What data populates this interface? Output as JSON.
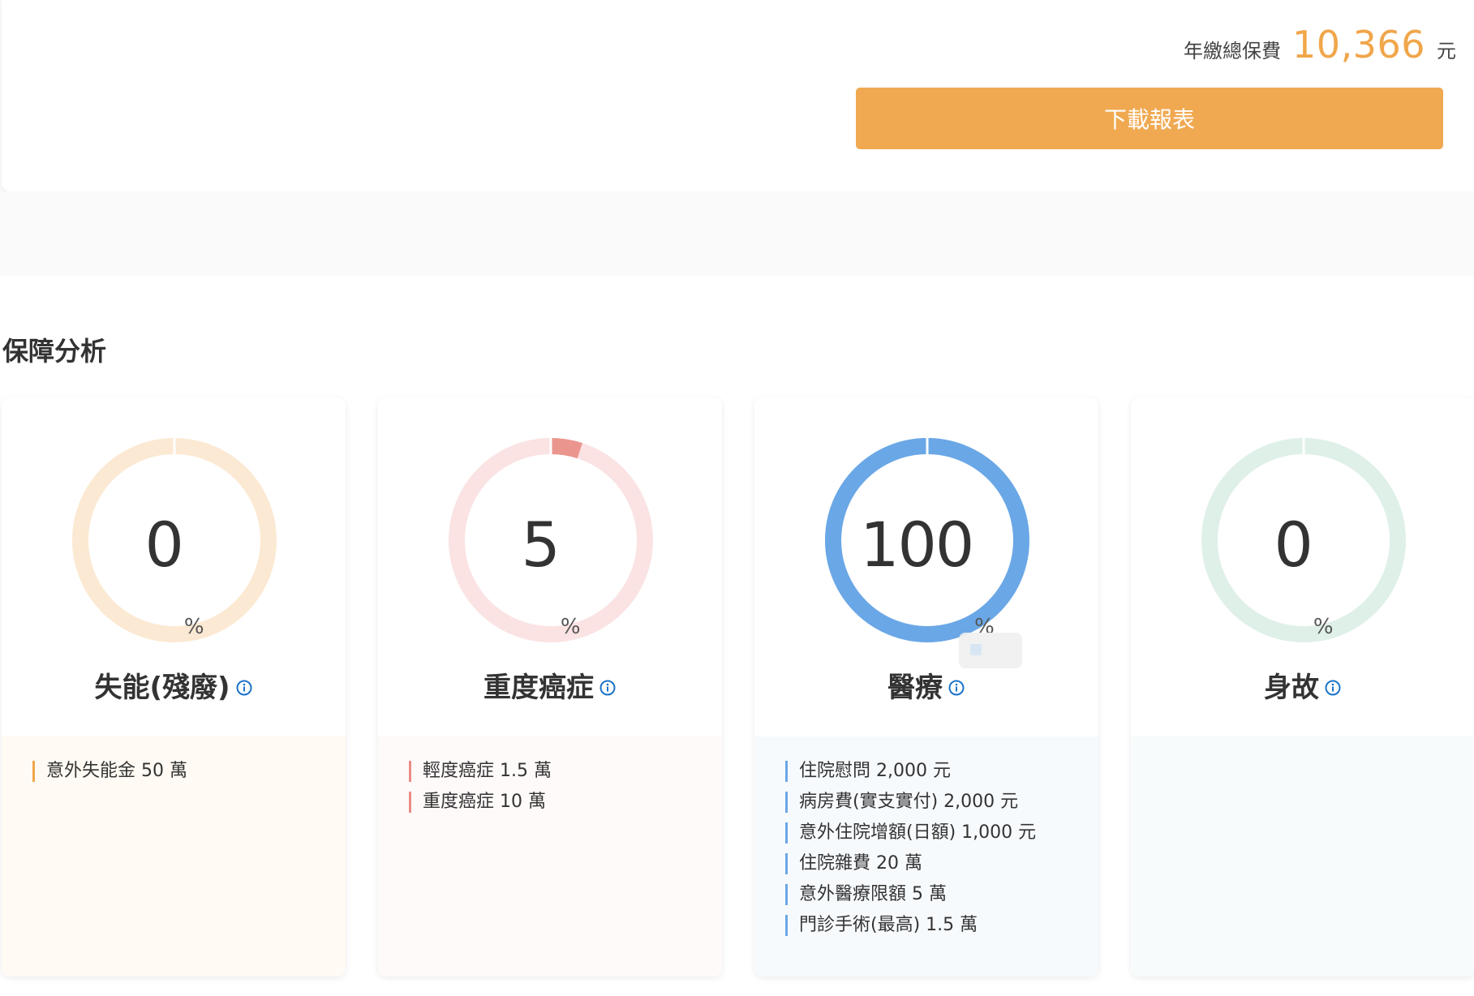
{
  "premium": {
    "label": "年繳總保費",
    "value": "10,366",
    "unit": "元"
  },
  "download_button": "下載報表",
  "section_title": "保障分析",
  "cards": [
    {
      "title": "失能(殘廢)",
      "percent": "0",
      "percent_symbol": "%",
      "progress": 0,
      "ring_color": "#fce9d3",
      "fill_color": "#f0a64a",
      "body_bg": "#fffaf3",
      "bar_color": "#f0a64a",
      "items": [
        "意外失能金 50 萬"
      ]
    },
    {
      "title": "重度癌症",
      "percent": "5",
      "percent_symbol": "%",
      "progress": 0.05,
      "ring_color": "#fbe3e3",
      "fill_color": "#eb958f",
      "body_bg": "#fefaf9",
      "bar_color": "#eb8c86",
      "items": [
        "輕度癌症 1.5 萬",
        "重度癌症 10 萬"
      ]
    },
    {
      "title": "醫療",
      "percent": "100",
      "percent_symbol": "%",
      "progress": 1.0,
      "ring_color": "#dbeafa",
      "fill_color": "#6aa7e6",
      "body_bg": "#f7fafd",
      "bar_color": "#6aa7e6",
      "items": [
        "住院慰問 2,000 元",
        "病房費(實支實付) 2,000 元",
        "意外住院增額(日額) 1,000 元",
        "住院雜費 20 萬",
        "意外醫療限額 5 萬",
        "門診手術(最高) 1.5 萬"
      ]
    },
    {
      "title": "身故",
      "percent": "0",
      "percent_symbol": "%",
      "progress": 0,
      "ring_color": "#dff0e8",
      "fill_color": "#6cc39c",
      "body_bg": "#f8fbfc",
      "bar_color": "#6cc39c",
      "items": []
    }
  ],
  "colors": {
    "accent": "#f0a64a",
    "info_icon": "#1a73c8"
  }
}
